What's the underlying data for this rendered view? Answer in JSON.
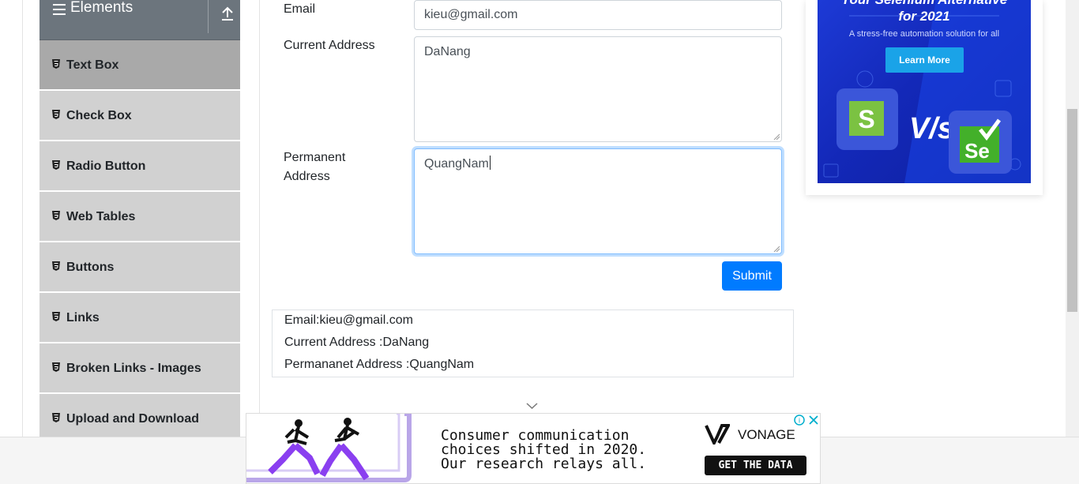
{
  "sidebar": {
    "group_title": "Elements",
    "items": [
      {
        "label": "Text Box",
        "active": true
      },
      {
        "label": "Check Box"
      },
      {
        "label": "Radio Button"
      },
      {
        "label": "Web Tables"
      },
      {
        "label": "Buttons"
      },
      {
        "label": "Links"
      },
      {
        "label": "Broken Links - Images"
      },
      {
        "label": "Upload and Download"
      }
    ]
  },
  "form": {
    "email_label": "Email",
    "email_value": "kieu@gmail.com",
    "current_address_label": "Current Address",
    "current_address_value": "DaNang",
    "permanent_address_label_line1": "Permanent",
    "permanent_address_label_line2": "Address",
    "permanent_address_value": "QuangNam",
    "submit_label": "Submit"
  },
  "output": {
    "email": "Email:kieu@gmail.com",
    "current_address": "Current Address :DaNang",
    "permanent_address": "Permananet Address :QuangNam"
  },
  "right_ad": {
    "headline_line1": "Your Selenium Alternative",
    "headline_line2": "for 2021",
    "subline": "A stress-free automation solution for all",
    "button": "Learn More",
    "vs_text": "V/s",
    "logo_left": "S",
    "logo_right": "Se"
  },
  "bottom_ad": {
    "line1": "Consumer communication",
    "line2": "choices shifted in 2020.",
    "line3": "Our research relays all.",
    "brand": "VONAGE",
    "cta": "GET THE DATA"
  },
  "colors": {
    "primary": "#007bff",
    "sidebar_header": "#6c757d",
    "sidebar_item": "#d1d1d1",
    "sidebar_item_active": "#a9a9a9",
    "ad_blue": "#1d3ad6"
  }
}
